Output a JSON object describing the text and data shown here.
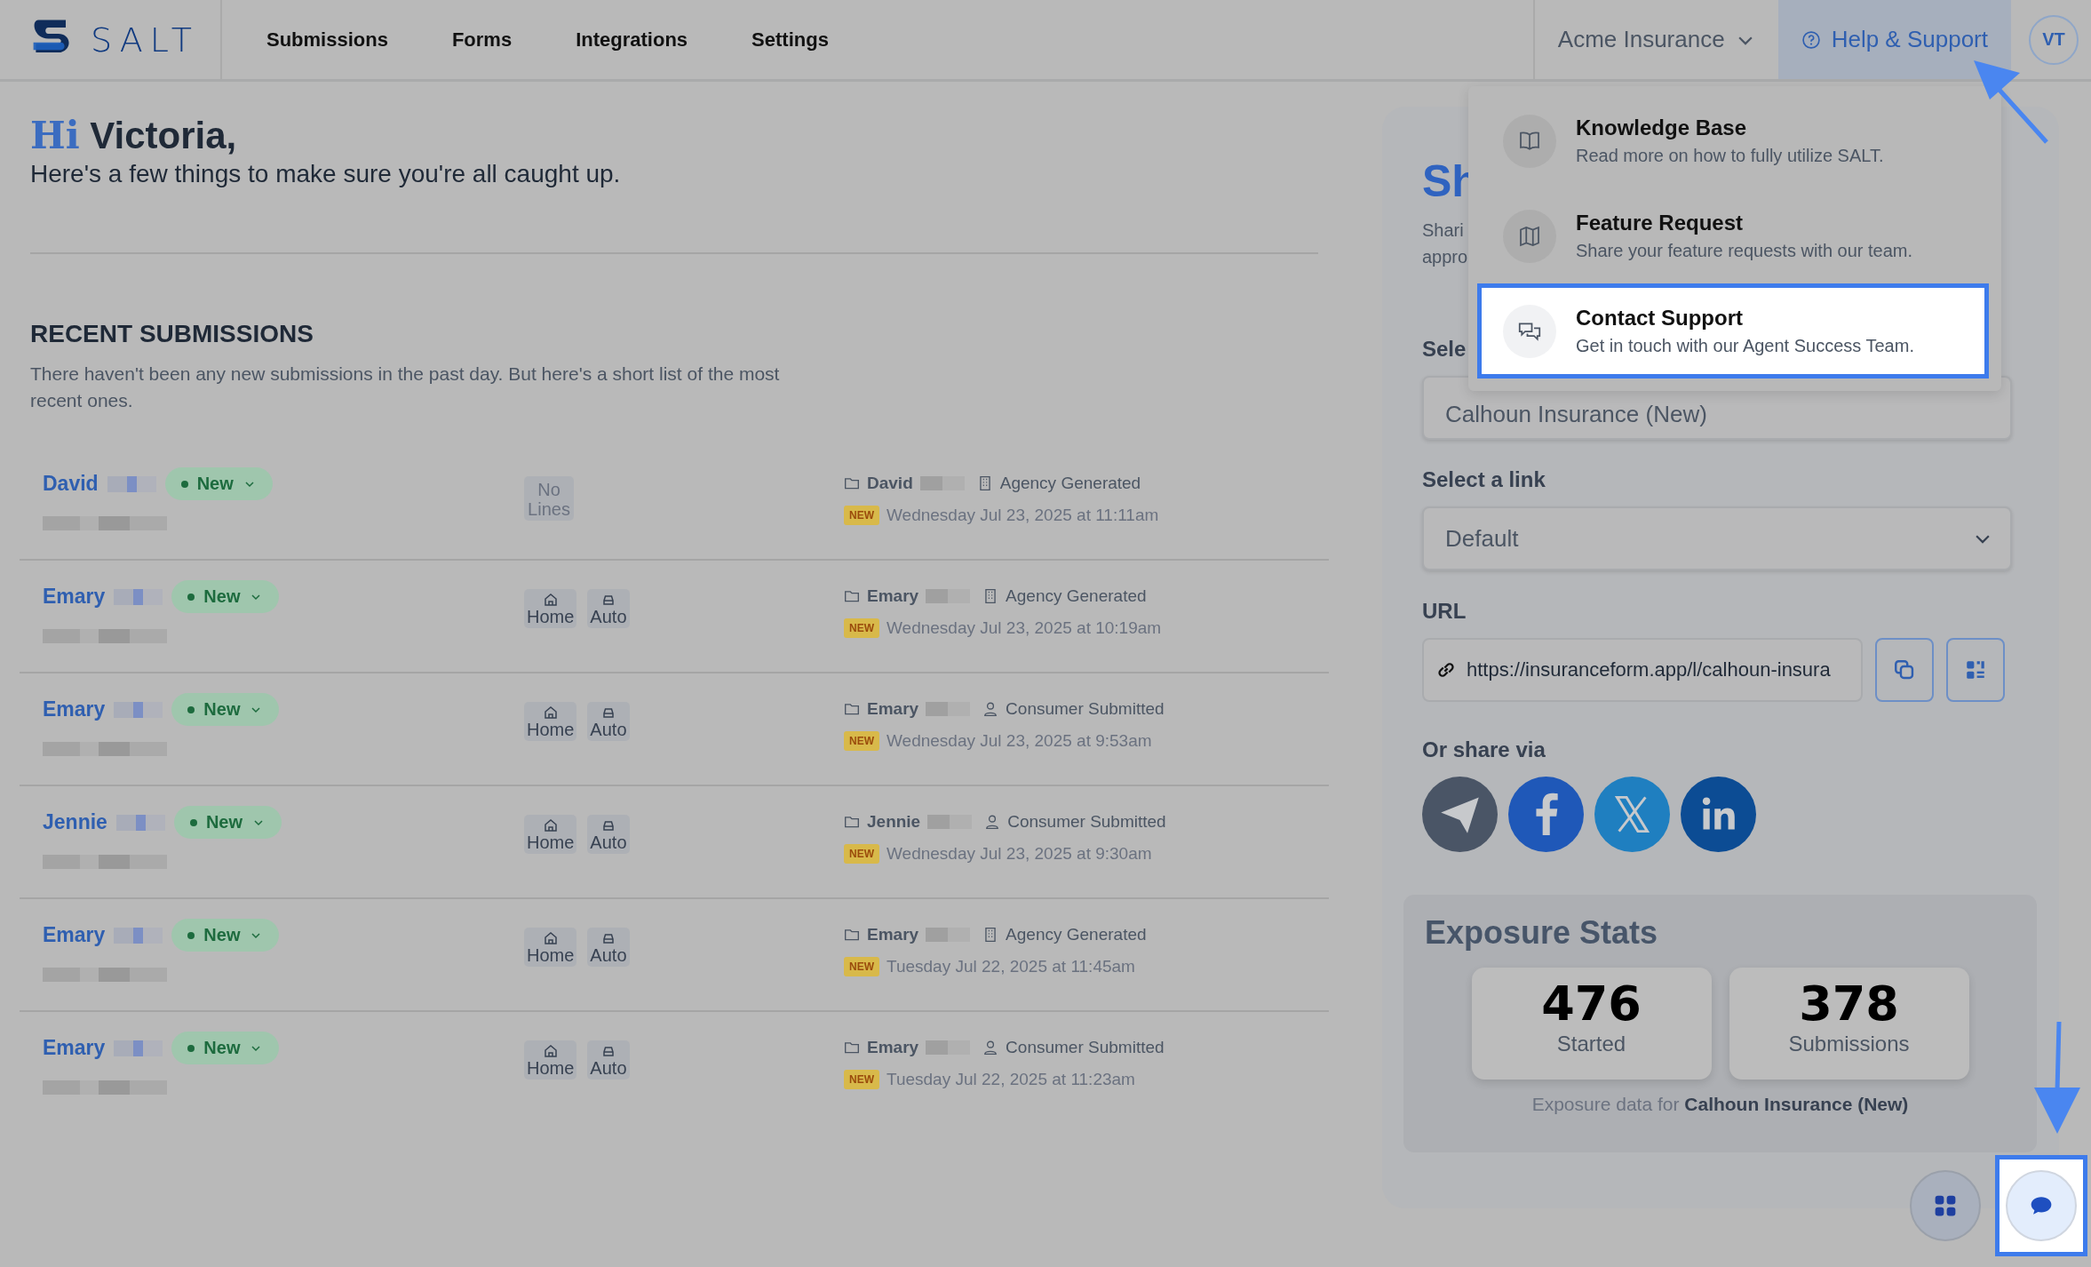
{
  "header": {
    "logo_text": "SALT",
    "nav": [
      {
        "label": "Submissions",
        "selected": false
      },
      {
        "label": "Forms",
        "selected": false
      },
      {
        "label": "Integrations",
        "selected": false
      },
      {
        "label": "Settings",
        "selected": false
      }
    ],
    "agency": "Acme Insurance",
    "help": {
      "label": "Help & Support",
      "expanded": true
    },
    "avatar": "VT"
  },
  "greeting": {
    "hi": "Hi",
    "name": "Victoria,",
    "subtitle": "Here's a few things to make sure you're all caught up."
  },
  "recent": {
    "title": "RECENT SUBMISSIONS",
    "description": "There haven't been any new submissions in the past day. But here's a short list of the most recent ones.",
    "rows": [
      {
        "name": "David",
        "status": "New",
        "lines": [
          {
            "kind": "empty",
            "label": "No Lines"
          }
        ],
        "owner": "David",
        "source": {
          "kind": "agency",
          "label": "Agency Generated"
        },
        "badge": "NEW",
        "date": "Wednesday Jul 23, 2025 at 11:11am"
      },
      {
        "name": "Emary",
        "status": "New",
        "lines": [
          {
            "kind": "home",
            "label": "Home"
          },
          {
            "kind": "auto",
            "label": "Auto"
          }
        ],
        "owner": "Emary",
        "source": {
          "kind": "agency",
          "label": "Agency Generated"
        },
        "badge": "NEW",
        "date": "Wednesday Jul 23, 2025 at 10:19am"
      },
      {
        "name": "Emary",
        "status": "New",
        "lines": [
          {
            "kind": "home",
            "label": "Home"
          },
          {
            "kind": "auto",
            "label": "Auto"
          }
        ],
        "owner": "Emary",
        "source": {
          "kind": "consumer",
          "label": "Consumer Submitted"
        },
        "badge": "NEW",
        "date": "Wednesday Jul 23, 2025 at 9:53am"
      },
      {
        "name": "Jennie",
        "status": "New",
        "lines": [
          {
            "kind": "home",
            "label": "Home"
          },
          {
            "kind": "auto",
            "label": "Auto"
          }
        ],
        "owner": "Jennie",
        "source": {
          "kind": "consumer",
          "label": "Consumer Submitted"
        },
        "badge": "NEW",
        "date": "Wednesday Jul 23, 2025 at 9:30am"
      },
      {
        "name": "Emary",
        "status": "New",
        "lines": [
          {
            "kind": "home",
            "label": "Home"
          },
          {
            "kind": "auto",
            "label": "Auto"
          }
        ],
        "owner": "Emary",
        "source": {
          "kind": "agency",
          "label": "Agency Generated"
        },
        "badge": "NEW",
        "date": "Tuesday Jul 22, 2025 at 11:45am"
      },
      {
        "name": "Emary",
        "status": "New",
        "lines": [
          {
            "kind": "home",
            "label": "Home"
          },
          {
            "kind": "auto",
            "label": "Auto"
          }
        ],
        "owner": "Emary",
        "source": {
          "kind": "consumer",
          "label": "Consumer Submitted"
        },
        "badge": "NEW",
        "date": "Tuesday Jul 22, 2025 at 11:23am"
      }
    ]
  },
  "share": {
    "title": "Sh",
    "description_lines": [
      "Shari",
      "appro"
    ],
    "select_label": "Sele",
    "select_value": "Calhoun Insurance (New)",
    "link_label": "Select a link",
    "link_value": "Default",
    "url_label": "URL",
    "url": "https://insuranceform.app/l/calhoun-insura",
    "share_label": "Or share via",
    "networks": [
      {
        "kind": "telegram"
      },
      {
        "kind": "facebook"
      },
      {
        "kind": "x"
      },
      {
        "kind": "linkedin"
      }
    ]
  },
  "exposure": {
    "title": "Exposure Stats",
    "stats": [
      {
        "value": "476",
        "label": "Started"
      },
      {
        "value": "378",
        "label": "Submissions"
      }
    ],
    "footer": "Exposure data for **Calhoun Insurance (New)**"
  },
  "help_menu": [
    {
      "kind": "book",
      "title": "Knowledge Base",
      "subtitle": "Read more on how to fully utilize SALT.",
      "highlighted": false
    },
    {
      "kind": "map",
      "title": "Feature Request",
      "subtitle": "Share your feature requests with our team.",
      "highlighted": false
    },
    {
      "kind": "chat",
      "title": "Contact Support",
      "subtitle": "Get in touch with our Agent Success Team.",
      "highlighted": true
    }
  ],
  "floating": [
    {
      "kind": "apps",
      "highlighted": false
    },
    {
      "kind": "chat",
      "highlighted": true
    }
  ]
}
